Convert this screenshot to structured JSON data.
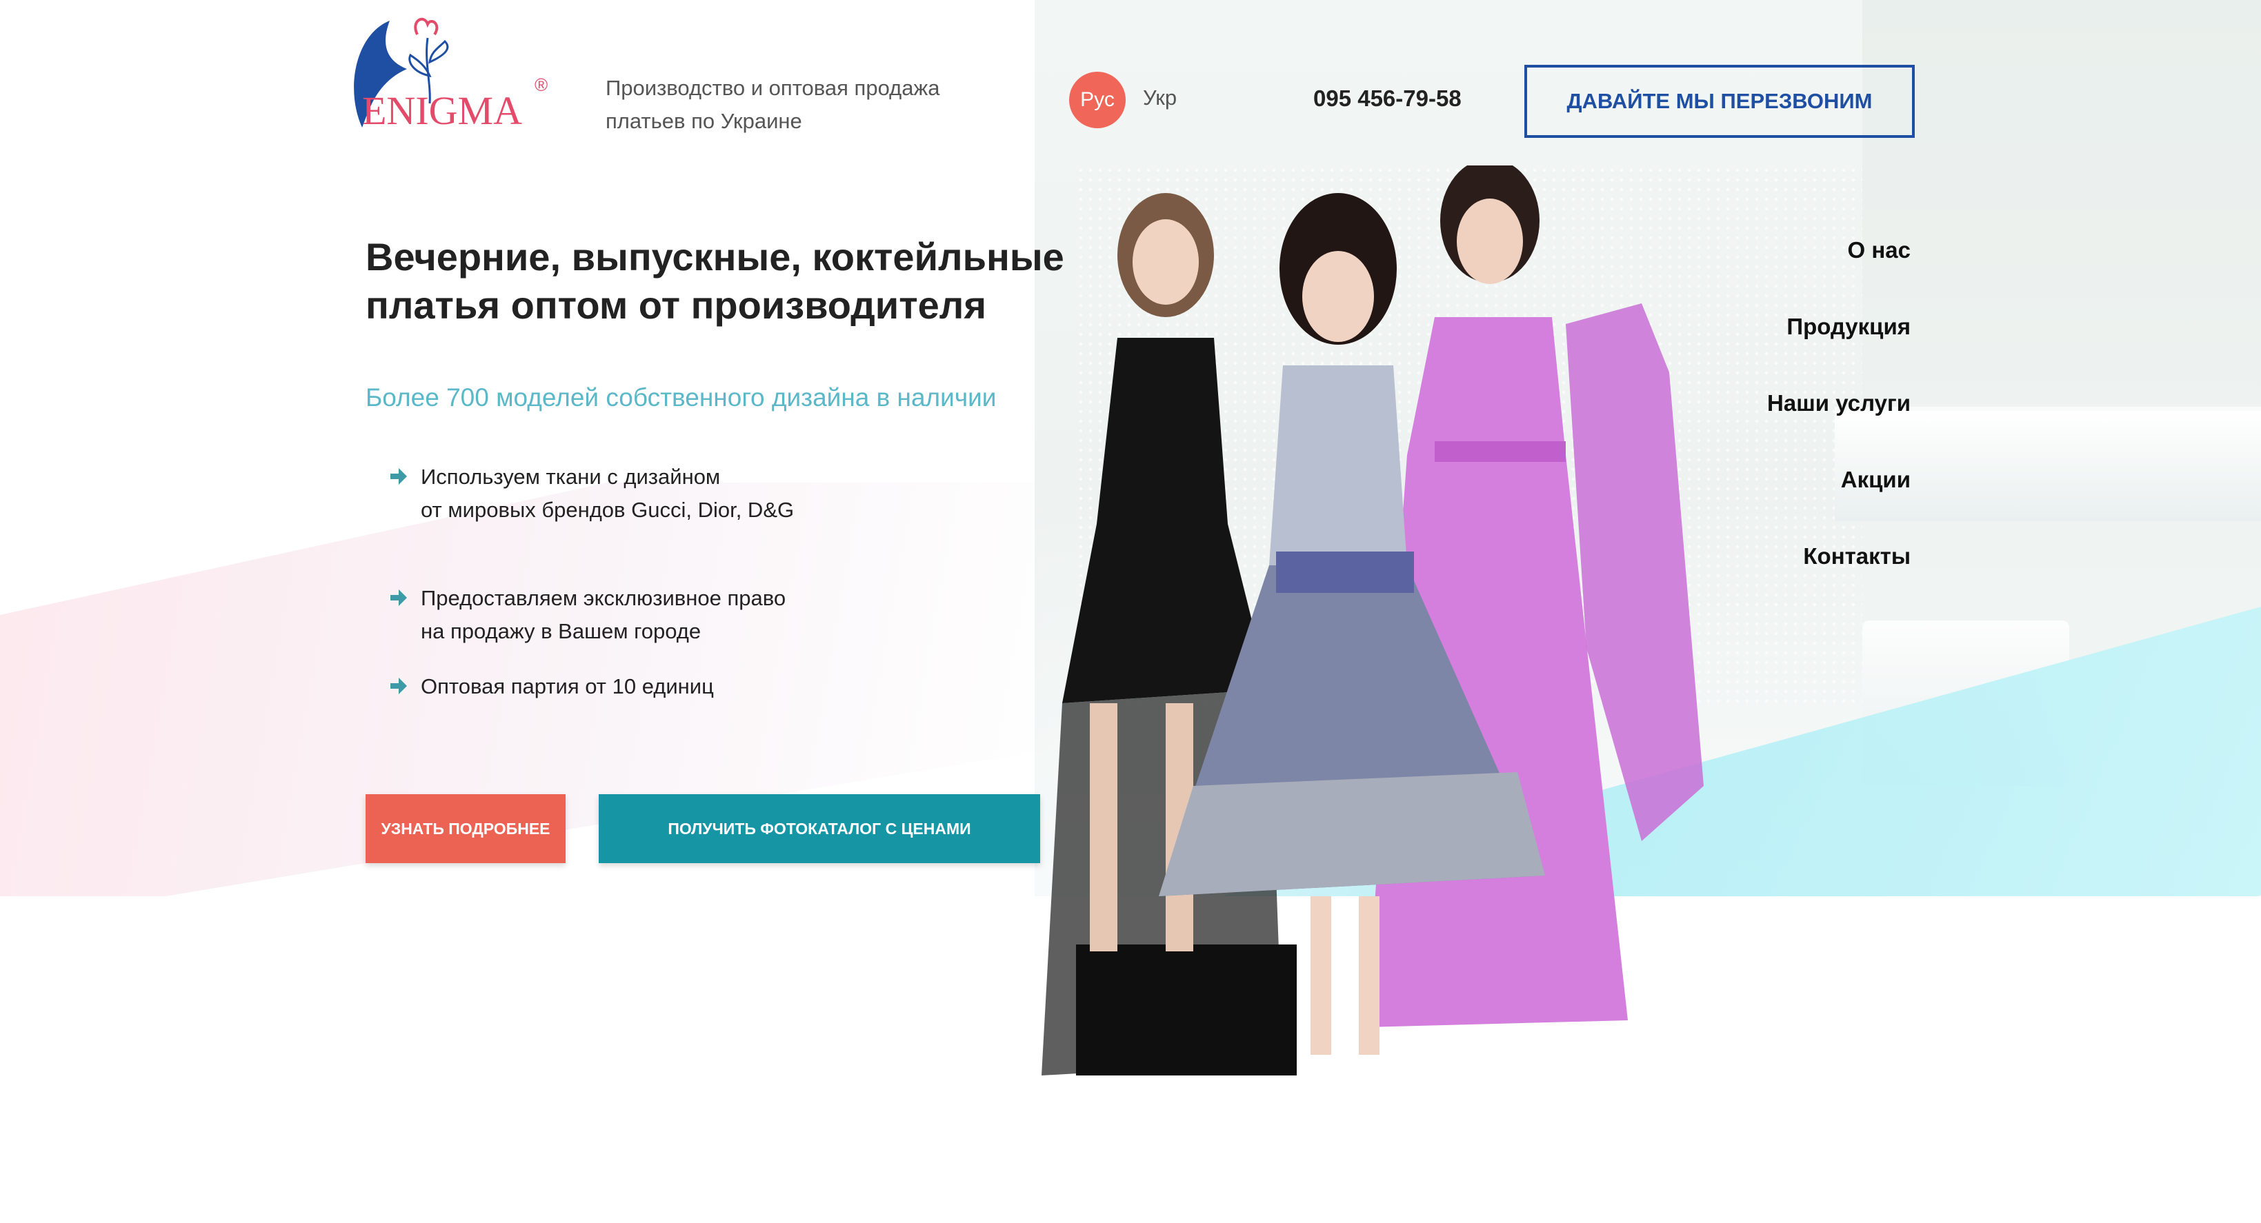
{
  "header": {
    "logo_text": "ENIGMA",
    "logo_mark": "®",
    "tagline_line1": "Производство и оптовая продажа",
    "tagline_line2": "платьев по Украине",
    "lang_ru": "Рус",
    "lang_ua": "Укр",
    "phone": "095 456-79-58",
    "callback_label": "Давайте мы перезвоним"
  },
  "nav": {
    "items": [
      {
        "label": "О нас"
      },
      {
        "label": "Продукция"
      },
      {
        "label": "Наши услуги"
      },
      {
        "label": "Акции"
      },
      {
        "label": "Контакты"
      }
    ]
  },
  "hero": {
    "title_line1": "Вечерние, выпускные, коктейльные",
    "title_line2": "платья оптом от производителя",
    "subtitle": "Более 700 моделей собственного дизайна в наличии",
    "features": [
      {
        "line1": "Используем ткани с дизайном",
        "line2": "от мировых брендов Gucci, Dior, D&G"
      },
      {
        "line1": "Предоставляем эксклюзивное право",
        "line2": "на продажу в Вашем городе"
      },
      {
        "line1": "Оптовая партия от 10 единиц",
        "line2": ""
      }
    ],
    "btn_more": "Узнать подробнее",
    "btn_catalog": "Получить фотокаталог с ценами"
  },
  "colors": {
    "accent_red": "#ec6354",
    "accent_teal": "#1695a5",
    "callback_blue": "#1f4fa2",
    "subtitle_cyan": "#5bb8c9",
    "arrow_teal": "#3f9aa8"
  },
  "icons": {
    "feature_bullet": "arrow-right-icon"
  }
}
